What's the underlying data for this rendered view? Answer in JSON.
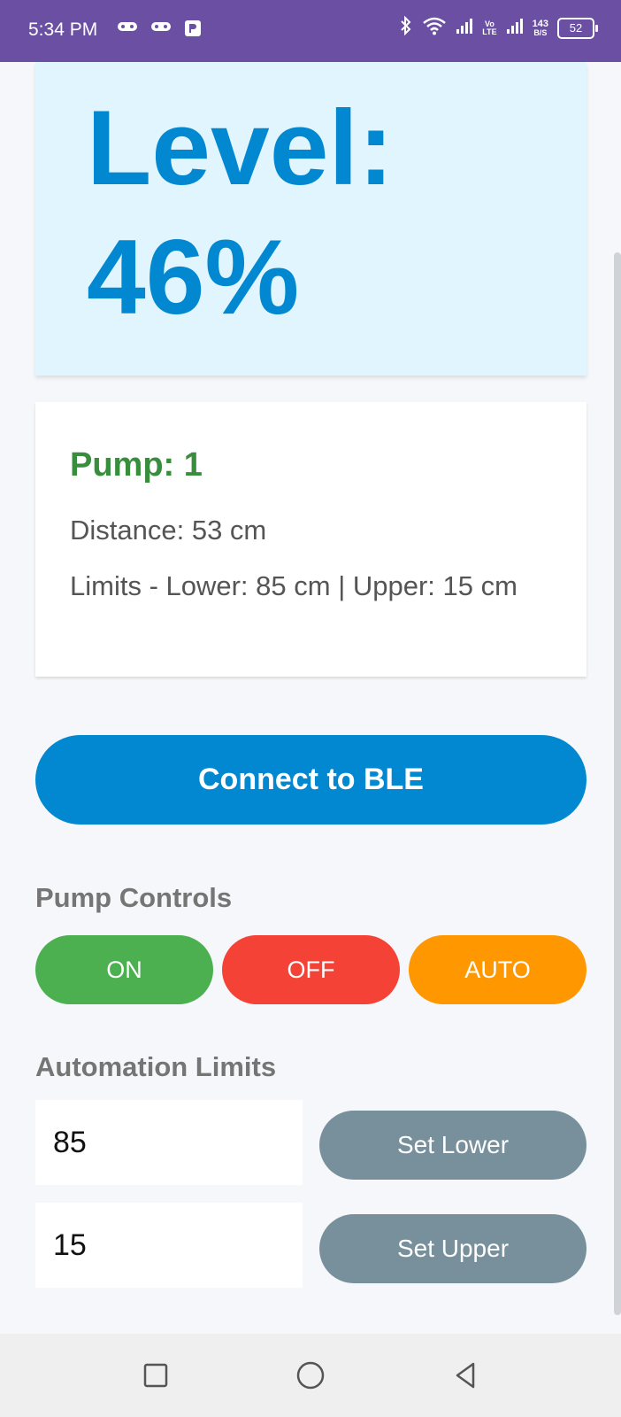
{
  "status_bar": {
    "time": "5:34 PM",
    "volte_top": "Vo",
    "volte_bottom": "LTE",
    "speed_value": "143",
    "speed_unit": "B/S",
    "battery": "52"
  },
  "level": {
    "text": "Level: 46%",
    "percent": 46
  },
  "info": {
    "pump_status": "Pump: 1",
    "distance": "Distance: 53 cm",
    "limits": "Limits - Lower: 85 cm | Upper: 15 cm"
  },
  "connect_button": "Connect to BLE",
  "pump_controls": {
    "title": "Pump Controls",
    "on": "ON",
    "off": "OFF",
    "auto": "AUTO"
  },
  "automation_limits": {
    "title": "Automation Limits",
    "lower_value": "85",
    "upper_value": "15",
    "set_lower": "Set Lower",
    "set_upper": "Set Upper"
  },
  "colors": {
    "status_bar": "#6a4fa3",
    "level_bg": "#e1f5fe",
    "level_text": "#0288d1",
    "pump_text": "#388e3c",
    "connect": "#0288d1",
    "on": "#4caf50",
    "off": "#f44336",
    "auto": "#ff9800",
    "set": "#78909c"
  }
}
